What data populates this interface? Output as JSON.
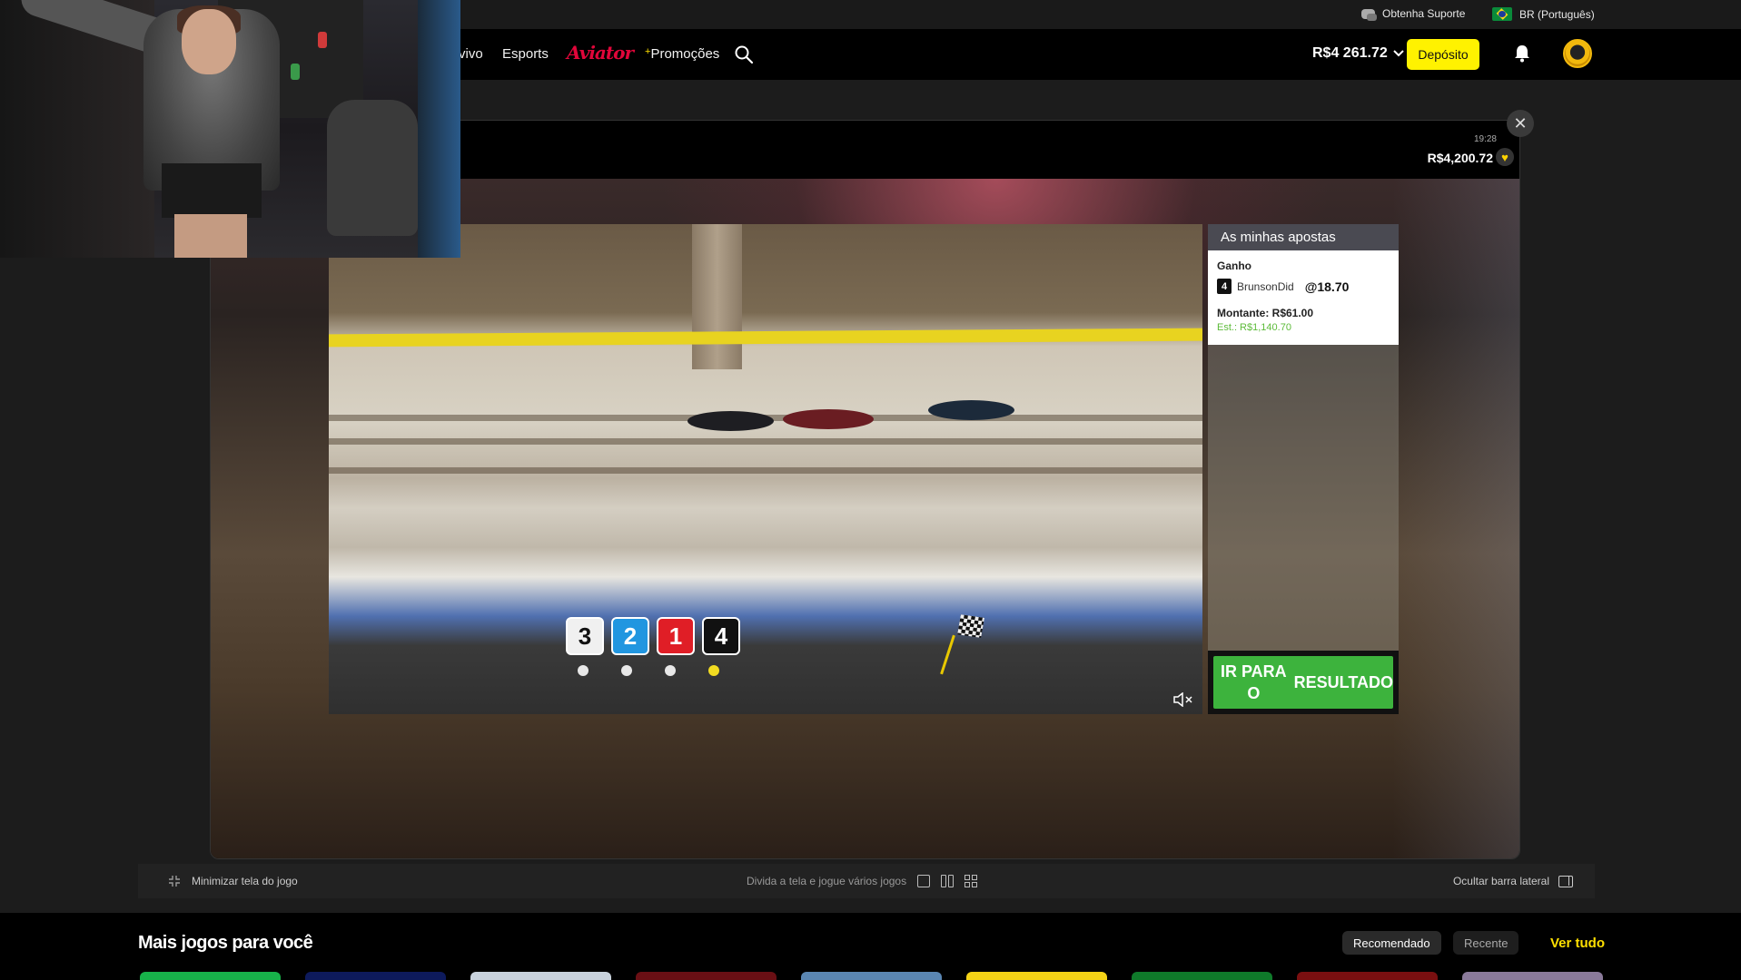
{
  "utility_bar": {
    "support_label": "Obtenha Suporte",
    "language_label": "BR (Português)"
  },
  "nav": {
    "links": [
      "vivo",
      "Esports",
      "Aviator",
      "Promoções"
    ],
    "promo_prefix": "+"
  },
  "account": {
    "balance": "R$4 261.72",
    "deposit_label": "Depósito"
  },
  "game": {
    "clock": "19:28",
    "jackpot": "R$4,200.72",
    "close_symbol": "✕",
    "race_positions": [
      {
        "number": "3",
        "color": "#f0f0f0"
      },
      {
        "number": "2",
        "color": "#2196e0"
      },
      {
        "number": "1",
        "color": "#e01e26"
      },
      {
        "number": "4",
        "color": "#111111"
      }
    ],
    "bets_panel": {
      "title": "As minhas apostas",
      "bet_type": "Ganho",
      "trap_number": "4",
      "runner": "BrunsonDid",
      "odds": "@18.70",
      "stake": "Montante: R$61.00",
      "estimated": "Est.: R$1,140.70",
      "result_button_line1": "IR PARA O",
      "result_button_line2": "RESULTADO"
    }
  },
  "toolbar": {
    "minimize_label": "Minimizar tela do jogo",
    "split_label": "Divida a tela e jogue vários jogos",
    "hide_sidebar_label": "Ocultar barra lateral"
  },
  "more_games": {
    "title": "Mais jogos para você",
    "tab_recommended": "Recomendado",
    "tab_recent": "Recente",
    "see_all": "Ver tudo",
    "thumbnail_colors": [
      "#17b24a",
      "#0d1a5c",
      "#c8d2dc",
      "#6a0f14",
      "#5a86b2",
      "#f5d316",
      "#0f7a2a",
      "#7a0f10",
      "#8a7a9a"
    ]
  },
  "colors": {
    "accent_yellow": "#fff200",
    "aviator_red": "#e1063a",
    "result_green": "#3db33d"
  }
}
